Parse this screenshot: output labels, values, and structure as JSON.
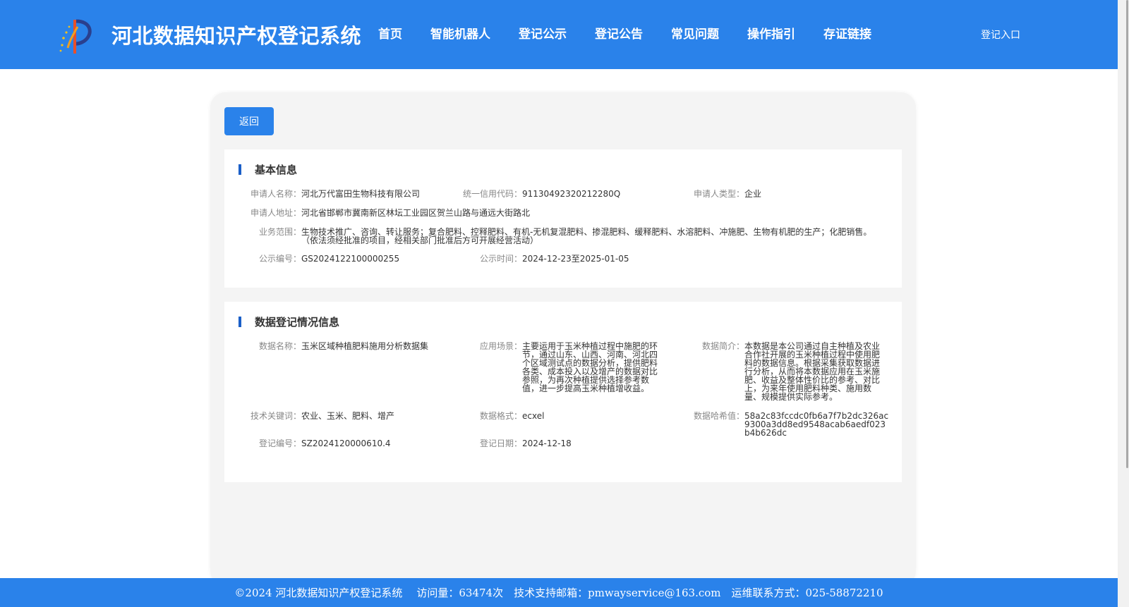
{
  "header": {
    "title": "河北数据知识产权登记系统",
    "nav": [
      "首页",
      "智能机器人",
      "登记公示",
      "登记公告",
      "常见问题",
      "操作指引",
      "存证链接"
    ],
    "login": "登记入口",
    "background": "#2a82ea"
  },
  "main": {
    "back_label": "返回"
  },
  "basic_info": {
    "title": "基本信息",
    "applicant_name": {
      "label": "申请人名称：",
      "value": "河北万代富田生物科技有限公司"
    },
    "credit_code": {
      "label": "统一信用代码：",
      "value": "91130492320212280Q"
    },
    "applicant_type": {
      "label": "申请人类型：",
      "value": "企业"
    },
    "applicant_address": {
      "label": "申请人地址：",
      "value": "河北省邯郸市冀南新区林坛工业园区贺兰山路与通远大街路北"
    },
    "business_scope": {
      "label": "业务范围：",
      "value": "生物技术推广、咨询、转让服务；复合肥料、控释肥料、有机-无机复混肥料、掺混肥料、缓释肥料、水溶肥料、冲施肥、生物有机肥的生产；化肥销售。（依法须经批准的项目，经相关部门批准后方可开展经营活动）"
    },
    "notice_no": {
      "label": "公示编号：",
      "value": "GS2024122100000255"
    },
    "notice_time": {
      "label": "公示时间：",
      "value": "2024-12-23至2025-01-05"
    }
  },
  "data_info": {
    "title": "数据登记情况信息",
    "data_name": {
      "label": "数据名称：",
      "value": "玉米区域种植肥料施用分析数据集"
    },
    "scenario": {
      "label": "应用场景：",
      "value": "主要运用于玉米种植过程中施肥的环节，通过山东、山西、河南、河北四个区域测试点的数据分析，提供肥料各类、成本投入以及增产的数据对比参照，为再次种植提供选择参考数值，进一步提高玉米种植增收益。"
    },
    "summary": {
      "label": "数据简介：",
      "value": "本数据是本公司通过自主种植及农业合作社开展的玉米种植过程中使用肥料的数据信息。根据采集获取数据进行分析，从而将本数据应用在玉米施肥、收益及整体性价比的参考、对比上，为来年使用肥料种类、施用数量、规模提供实际参考。"
    },
    "keywords": {
      "label": "技术关键词：",
      "value": "农业、玉米、肥料、增产"
    },
    "format": {
      "label": "数据格式：",
      "value": "ecxel"
    },
    "hash": {
      "label": "数据哈希值：",
      "value": "58a2c83fccdc0fb6a7f7b2dc326ac9300a3dd8ed9548acab6aedf023b4b626dc"
    },
    "reg_no": {
      "label": "登记编号：",
      "value": "SZ2024120000610.4"
    },
    "reg_date": {
      "label": "登记日期：",
      "value": "2024-12-18"
    }
  },
  "footer": {
    "copyright": "©2024 河北数据知识产权登记系统",
    "visits": "访问量：63474次",
    "email": "技术支持邮箱：pmwayservice@163.com",
    "contact": "运维联系方式：025-58872210"
  }
}
